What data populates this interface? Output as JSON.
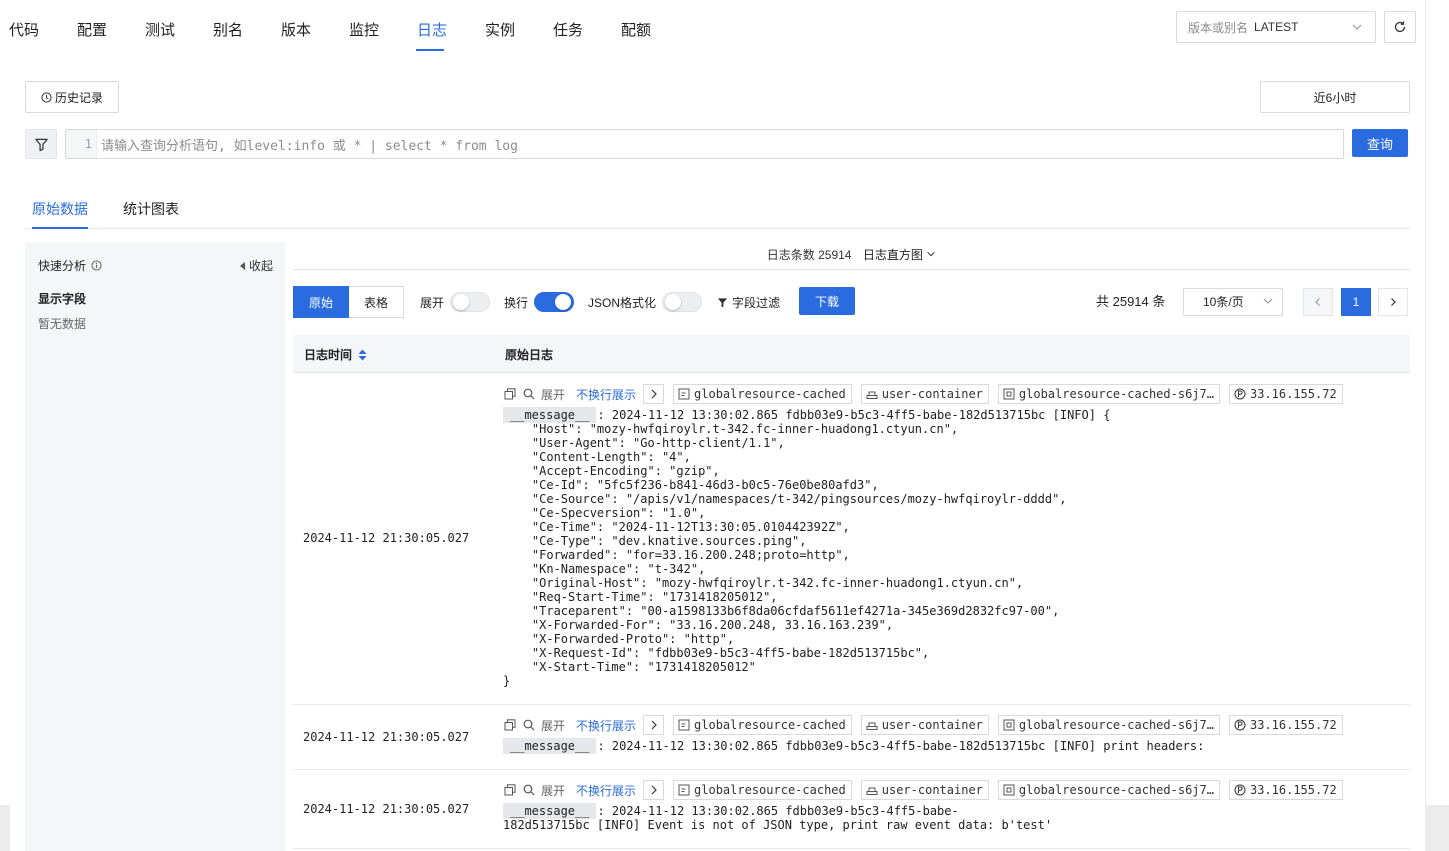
{
  "top_tabs": [
    {
      "label": "代码",
      "active": false
    },
    {
      "label": "配置",
      "active": false
    },
    {
      "label": "测试",
      "active": false
    },
    {
      "label": "别名",
      "active": false
    },
    {
      "label": "版本",
      "active": false
    },
    {
      "label": "监控",
      "active": false
    },
    {
      "label": "日志",
      "active": true
    },
    {
      "label": "实例",
      "active": false
    },
    {
      "label": "任务",
      "active": false
    },
    {
      "label": "配额",
      "active": false
    }
  ],
  "version_select": {
    "placeholder": "版本或别名",
    "value": "LATEST"
  },
  "history_label": "历史记录",
  "time_range_label": "近6小时",
  "query": {
    "line_number": "1",
    "placeholder": "请输入查询分析语句, 如level:info 或 * | select * from log",
    "button_label": "查询"
  },
  "sub_tabs": [
    {
      "label": "原始数据",
      "active": true
    },
    {
      "label": "统计图表",
      "active": false
    }
  ],
  "side": {
    "title": "快速分析",
    "collapse_label": "收起",
    "fields_title": "显示字段",
    "empty_text": "暂无数据"
  },
  "histogram": {
    "count_label": "日志条数 25914",
    "toggle_label": "日志直方图"
  },
  "toolbar": {
    "raw_label": "原始",
    "table_label": "表格",
    "expand_label": "展开",
    "expand_on": false,
    "wrap_label": "换行",
    "wrap_on": true,
    "json_label": "JSON格式化",
    "json_on": false,
    "field_filter_label": "字段过滤",
    "download_label": "下载",
    "total_label": "共 25914 条",
    "page_size": "10条/页",
    "current_page": "1"
  },
  "table": {
    "col_time": "日志时间",
    "col_raw": "原始日志"
  },
  "tag_labels": {
    "expand": "展开",
    "nowrap": "不换行展示"
  },
  "rows": [
    {
      "time": "2024-11-12 21:30:05.027",
      "tags": [
        "globalresource-cached",
        "user-container",
        "globalresource-cached-s6j7…",
        "33.16.155.72"
      ],
      "key": "__message__",
      "message": ": 2024-11-12 13:30:02.865 fdbb03e9-b5c3-4ff5-babe-182d513715bc [INFO] {\n    \"Host\": \"mozy-hwfqiroylr.t-342.fc-inner-huadong1.ctyun.cn\",\n    \"User-Agent\": \"Go-http-client/1.1\",\n    \"Content-Length\": \"4\",\n    \"Accept-Encoding\": \"gzip\",\n    \"Ce-Id\": \"5fc5f236-b841-46d3-b0c5-76e0be80afd3\",\n    \"Ce-Source\": \"/apis/v1/namespaces/t-342/pingsources/mozy-hwfqiroylr-dddd\",\n    \"Ce-Specversion\": \"1.0\",\n    \"Ce-Time\": \"2024-11-12T13:30:05.010442392Z\",\n    \"Ce-Type\": \"dev.knative.sources.ping\",\n    \"Forwarded\": \"for=33.16.200.248;proto=http\",\n    \"Kn-Namespace\": \"t-342\",\n    \"Original-Host\": \"mozy-hwfqiroylr.t-342.fc-inner-huadong1.ctyun.cn\",\n    \"Req-Start-Time\": \"1731418205012\",\n    \"Traceparent\": \"00-a1598133b6f8da06cfdaf5611ef4271a-345e369d2832fc97-00\",\n    \"X-Forwarded-For\": \"33.16.200.248, 33.16.163.239\",\n    \"X-Forwarded-Proto\": \"http\",\n    \"X-Request-Id\": \"fdbb03e9-b5c3-4ff5-babe-182d513715bc\",\n    \"X-Start-Time\": \"1731418205012\"\n}"
    },
    {
      "time": "2024-11-12 21:30:05.027",
      "tags": [
        "globalresource-cached",
        "user-container",
        "globalresource-cached-s6j7…",
        "33.16.155.72"
      ],
      "key": "__message__",
      "message": ": 2024-11-12 13:30:02.865 fdbb03e9-b5c3-4ff5-babe-182d513715bc [INFO] print headers:"
    },
    {
      "time": "2024-11-12 21:30:05.027",
      "tags": [
        "globalresource-cached",
        "user-container",
        "globalresource-cached-s6j7…",
        "33.16.155.72"
      ],
      "key": "__message__",
      "message": ": 2024-11-12 13:30:02.865 fdbb03e9-b5c3-4ff5-babe-\n182d513715bc [INFO] Event is not of JSON type, print raw event data: b'test'"
    }
  ],
  "colors": {
    "accent": "#2a6ce0",
    "panel_bg": "#f5f6f8",
    "border": "#d9d9d9"
  }
}
